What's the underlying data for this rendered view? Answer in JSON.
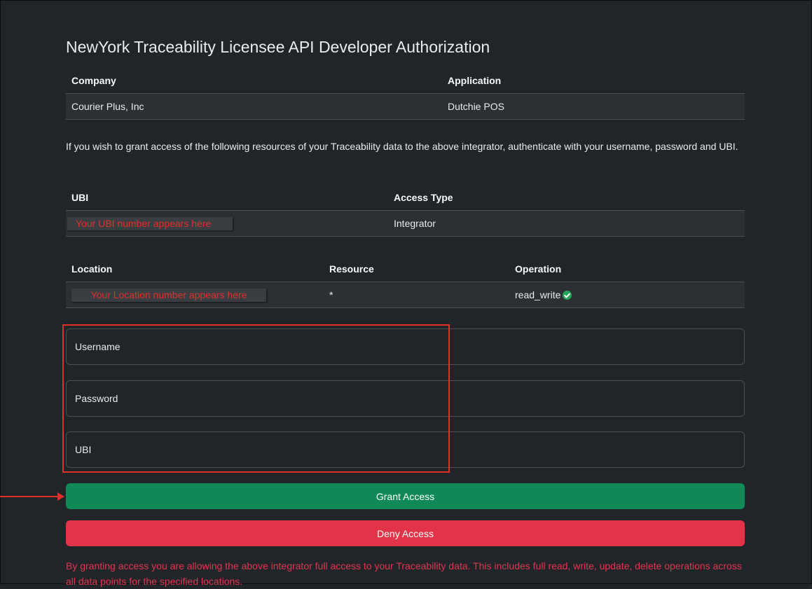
{
  "page": {
    "title": "NewYork Traceability Licensee API Developer Authorization"
  },
  "integrator_table": {
    "headers": [
      "Company",
      "Application"
    ],
    "row": [
      "Courier Plus, Inc",
      "Dutchie POS"
    ]
  },
  "intro_text": "If you wish to grant access of the following resources of your Traceability data to the above integrator, authenticate with your username, password and UBI.",
  "ubi_table": {
    "headers": [
      "UBI",
      "Access Type"
    ],
    "ubi_placeholder": "Your UBI number appears here",
    "access_type": "Integrator"
  },
  "location_table": {
    "headers": [
      "Location",
      "Resource",
      "Operation"
    ],
    "location_placeholder": "Your Location number appears here",
    "resource": "*",
    "operation": "read_write"
  },
  "form": {
    "username_label": "Username",
    "password_label": "Password",
    "ubi_label": "UBI"
  },
  "buttons": {
    "grant": "Grant Access",
    "deny": "Deny Access"
  },
  "warning_text": "By granting access you are allowing the above integrator full access to your Traceability data. This includes full read, write, update, delete operations across all data points for the specified locations.",
  "colors": {
    "background": "#212529",
    "grant": "#0f8a56",
    "deny": "#e13449",
    "annotation": "#e0302b"
  }
}
